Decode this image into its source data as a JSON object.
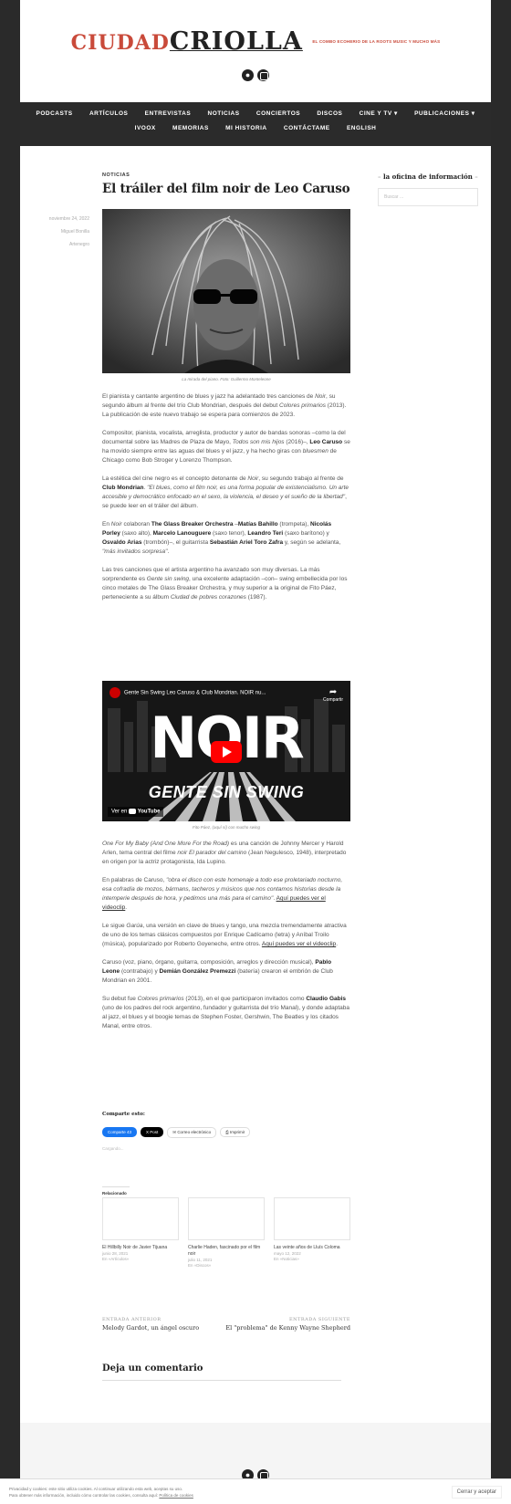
{
  "site": {
    "logo_word1": "CIUDAD",
    "logo_word2": "CRIOLLA",
    "tagline": "EL COMBO ECOHERIO DE LA ROOTS MUSIC Y MUCHO MÁS"
  },
  "nav": {
    "row1": [
      "PODCASTS",
      "ARTÍCULOS",
      "ENTREVISTAS",
      "NOTICIAS",
      "CONCIERTOS",
      "DISCOS",
      "CINE Y TV ▾",
      "PUBLICACIONES ▾"
    ],
    "row2": [
      "IVOOX",
      "MEMORIAS",
      "MI HISTORIA",
      "CONTÁCTAME",
      "ENGLISH"
    ]
  },
  "post": {
    "category": "NOTICIAS",
    "title": "El tráiler del film noir de Leo Caruso",
    "date": "noviembre 24, 2022",
    "author": "Miguel Bonilla",
    "tag": "Artenegro",
    "photo_caption": "La mirada del piano. Foto: Guillermo Monteleone",
    "video_title": "Gente Sin Swing Leo Caruso & Club Mondrian. NOIR nu...",
    "video_share": "Compartir",
    "video_watch": "Ver en",
    "video_brand": "YouTube",
    "video_noir": "NOIR",
    "video_sub": "GENTE SIN SWING",
    "video_caption": "Fito Páez, (aquí sí) con mucho swing"
  },
  "sidebar": {
    "title": "la oficina de información",
    "search_placeholder": "Buscar ..."
  },
  "share": {
    "title": "Comparte esto:",
    "fb": "Comparte 43",
    "x": "X Post",
    "email": "Correo electrónico",
    "print": "Imprimir",
    "loading": "Cargando..."
  },
  "related": {
    "title": "Relacionado",
    "items": [
      {
        "title": "El Hillbilly Noir de Javier Tijuana",
        "date": "junio 28, 2021",
        "sub": "En «Artículos»"
      },
      {
        "title": "Charlie Haden, fascinado por el film noir",
        "date": "julio 11, 2021",
        "sub": "En «Discos»"
      },
      {
        "title": "Las veinte años de Lluís Coloma",
        "date": "mayo 12, 2022",
        "sub": "En «Noticias»"
      }
    ]
  },
  "postnav": {
    "prev_label": "ENTRADA ANTERIOR",
    "prev_title": "Melody Gardot, un ángel oscuro",
    "next_label": "ENTRADA SIGUIENTE",
    "next_title": "El \"problema\" de Kenny Wayne Shepherd"
  },
  "comment": {
    "title": "Deja un comentario"
  },
  "cookie": {
    "line1": "Privacidad y cookies: este sitio utiliza cookies. Al continuar utilizando esta web, aceptas su uso.",
    "line2": "Para obtener más información, incluido cómo controlar las cookies, consulta aquí:",
    "link": "Política de cookies",
    "button": "Cerrar y aceptar"
  },
  "colors": {
    "accent": "#c94a3a",
    "nav_bg": "#2b2b2b",
    "youtube_red": "#ff0000"
  }
}
